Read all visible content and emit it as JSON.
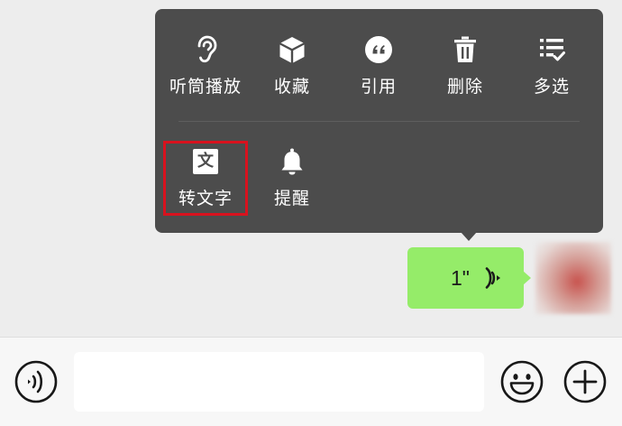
{
  "menu": {
    "row1": [
      {
        "label": "听筒播放",
        "icon": "ear-icon"
      },
      {
        "label": "收藏",
        "icon": "cube-icon"
      },
      {
        "label": "引用",
        "icon": "quote-icon"
      },
      {
        "label": "删除",
        "icon": "trash-icon"
      },
      {
        "label": "多选",
        "icon": "multi-select-icon"
      }
    ],
    "row2": [
      {
        "label": "转文字",
        "icon": "text-convert-icon",
        "glyph": "文",
        "highlighted": true
      },
      {
        "label": "提醒",
        "icon": "bell-icon"
      }
    ]
  },
  "message": {
    "duration": "1\"",
    "icon": "voice-wave-icon",
    "bubble_color": "#95ec69"
  },
  "input_bar": {
    "left_icon": "voice-mode-icon",
    "input_value": "",
    "emoji_icon": "emoji-icon",
    "plus_icon": "plus-icon"
  },
  "colors": {
    "background": "#ededed",
    "menu_background": "#4c4c4c",
    "highlight_border": "#d8121e"
  }
}
